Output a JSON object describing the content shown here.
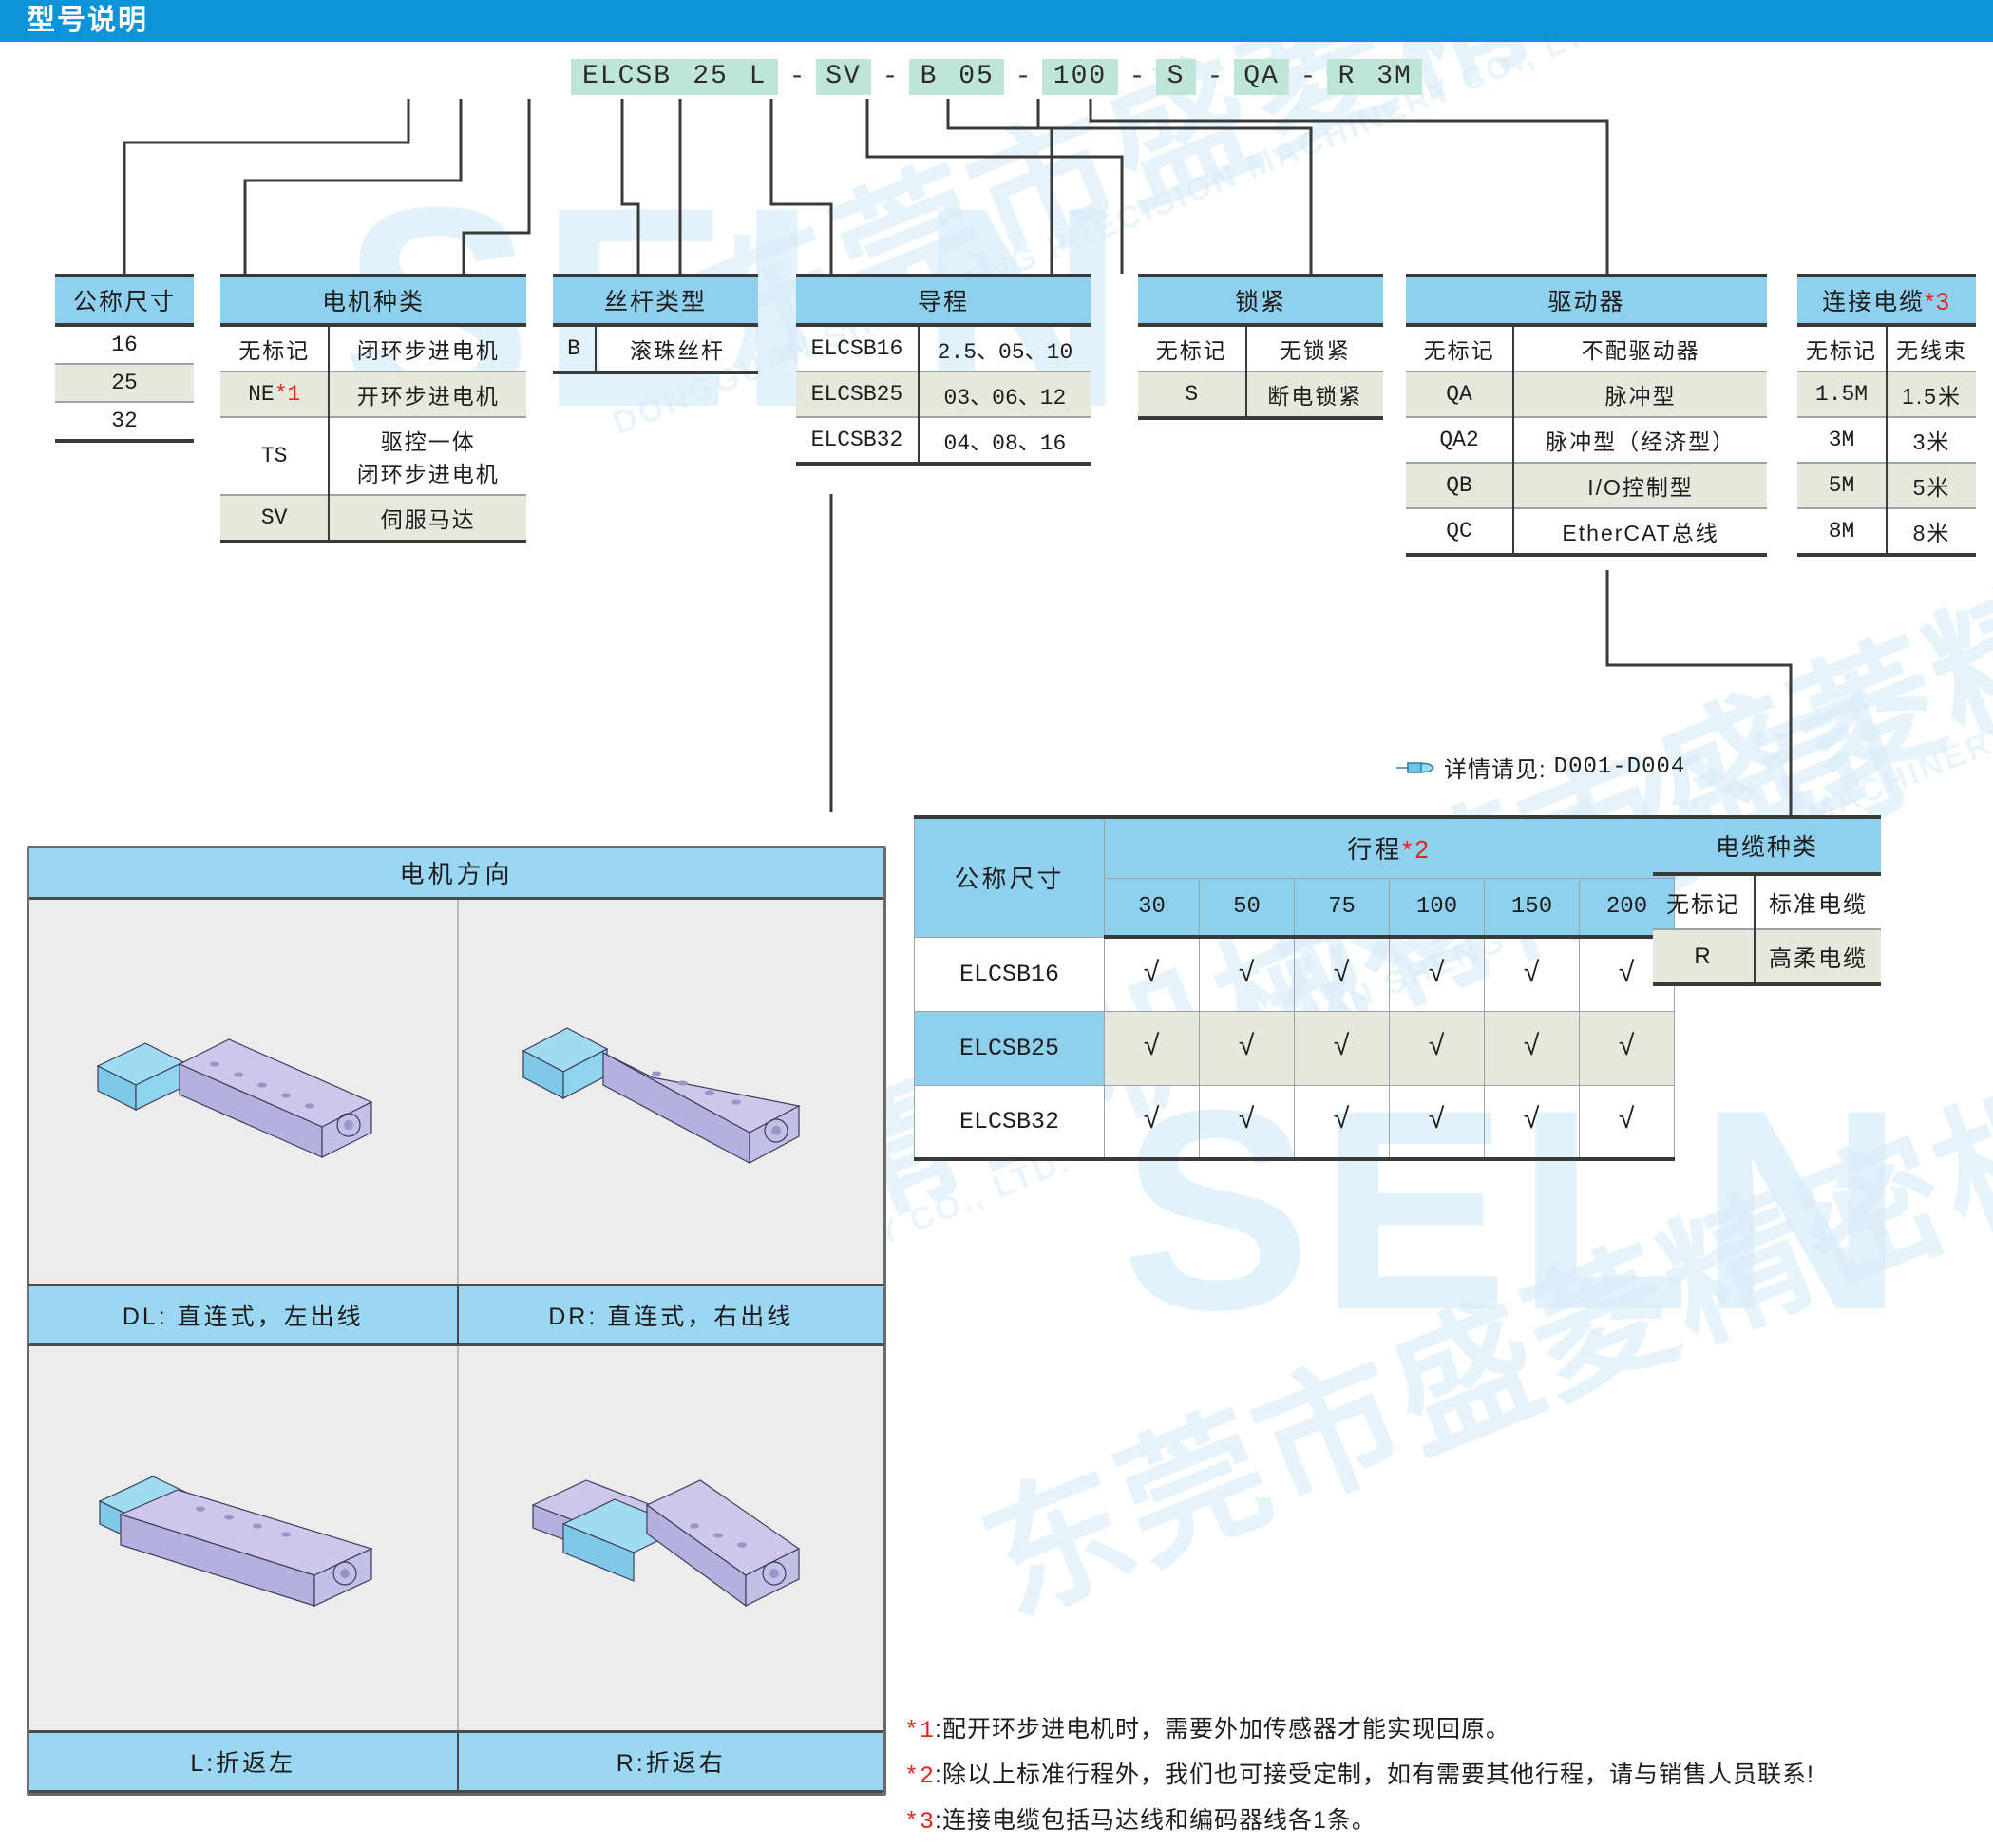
{
  "header": {
    "title": "型号说明"
  },
  "model_code": {
    "segments": [
      {
        "text": "ELCSB",
        "type": "chip",
        "width": 118
      },
      {
        "text": "25",
        "type": "chip",
        "width": 58
      },
      {
        "text": "L",
        "type": "chip",
        "width": 42
      },
      {
        "text": "-",
        "type": "dash"
      },
      {
        "text": "SV",
        "type": "chip",
        "width": 58
      },
      {
        "text": "-",
        "type": "dash"
      },
      {
        "text": "B",
        "type": "chip",
        "width": 42
      },
      {
        "text": "05",
        "type": "chip",
        "width": 58
      },
      {
        "text": "-",
        "type": "dash"
      },
      {
        "text": "100",
        "type": "chip",
        "width": 80
      },
      {
        "text": "-",
        "type": "dash"
      },
      {
        "text": "S",
        "type": "chip",
        "width": 42
      },
      {
        "text": "-",
        "type": "dash"
      },
      {
        "text": "QA",
        "type": "chip",
        "width": 58
      },
      {
        "text": "-",
        "type": "dash"
      },
      {
        "text": "R",
        "type": "chip",
        "width": 42
      },
      {
        "text": "3M",
        "type": "chip",
        "width": 58
      }
    ]
  },
  "tables": {
    "nominal_size": {
      "header": "公称尺寸",
      "rows": [
        {
          "code": "16"
        },
        {
          "code": "25"
        },
        {
          "code": "32"
        }
      ]
    },
    "motor_type": {
      "header": "电机种类",
      "rows": [
        {
          "code": "无标记",
          "desc": "闭环步进电机"
        },
        {
          "code": "NE",
          "code_star": "*1",
          "desc": "开环步进电机"
        },
        {
          "code": "TS",
          "desc": "驱控一体\n闭环步进电机"
        },
        {
          "code": "SV",
          "desc": "伺服马达"
        }
      ]
    },
    "screw_type": {
      "header": "丝杆类型",
      "rows": [
        {
          "code": "B",
          "desc": "滚珠丝杆"
        }
      ]
    },
    "lead": {
      "header": "导程",
      "rows": [
        {
          "code": "ELCSB16",
          "desc": "2.5、05、10"
        },
        {
          "code": "ELCSB25",
          "desc": "03、06、12"
        },
        {
          "code": "ELCSB32",
          "desc": "04、08、16"
        }
      ]
    },
    "lock": {
      "header": "锁紧",
      "rows": [
        {
          "code": "无标记",
          "desc": "无锁紧"
        },
        {
          "code": "S",
          "desc": "断电锁紧"
        }
      ]
    },
    "driver": {
      "header": "驱动器",
      "rows": [
        {
          "code": "无标记",
          "desc": "不配驱动器"
        },
        {
          "code": "QA",
          "desc": "脉冲型"
        },
        {
          "code": "QA2",
          "desc": "脉冲型（经济型）"
        },
        {
          "code": "QB",
          "desc": "I/O控制型"
        },
        {
          "code": "QC",
          "desc": "EtherCAT总线"
        }
      ],
      "note_prefix": "详情请见:",
      "note_code": "D001-D004"
    },
    "connect_cable": {
      "header": "连接电缆",
      "header_star": "*3",
      "rows": [
        {
          "code": "无标记",
          "desc": "无线束"
        },
        {
          "code": "1.5M",
          "desc": "1.5米"
        },
        {
          "code": "3M",
          "desc": "3米"
        },
        {
          "code": "5M",
          "desc": "5米"
        },
        {
          "code": "8M",
          "desc": "8米"
        }
      ]
    },
    "cable_type": {
      "header": "电缆种类",
      "rows": [
        {
          "code": "无标记",
          "desc": "标准电缆"
        },
        {
          "code": "R",
          "desc": "高柔电缆"
        }
      ]
    }
  },
  "motor_direction": {
    "title": "电机方向",
    "cells": [
      {
        "label": "DL: 直连式，左出线"
      },
      {
        "label": "DR: 直连式，右出线"
      },
      {
        "label": "L:折返左"
      },
      {
        "label": "R:折返右"
      }
    ]
  },
  "chart_data": {
    "type": "table",
    "title": "行程*2",
    "title_text": "行程",
    "title_star": "*2",
    "corner_label": "公称尺寸",
    "categories": [
      "30",
      "50",
      "75",
      "100",
      "150",
      "200"
    ],
    "rows": [
      {
        "name": "ELCSB16",
        "values": [
          "√",
          "√",
          "√",
          "√",
          "√",
          "√"
        ],
        "banded": false
      },
      {
        "name": "ELCSB25",
        "values": [
          "√",
          "√",
          "√",
          "√",
          "√",
          "√"
        ],
        "banded": true
      },
      {
        "name": "ELCSB32",
        "values": [
          "√",
          "√",
          "√",
          "√",
          "√",
          "√"
        ],
        "banded": false
      }
    ]
  },
  "footnotes": [
    {
      "mark": "*1",
      "text": ":配开环步进电机时，需要外加传感器才能实现回原。"
    },
    {
      "mark": "*2",
      "text": ":除以上标准行程外，我们也可接受定制，如有需要其他行程，请与销售人员联系!"
    },
    {
      "mark": "*3",
      "text": ":连接电缆包括马达线和编码器线各1条。"
    }
  ],
  "watermark": {
    "logo": "SELN",
    "cn": "东莞市盛菱精密机械有限公司",
    "en": "DONGGUAN SHENG LING PRECISION MACHINERY CO., LTD."
  },
  "colors": {
    "header_blue": "#0d93d8",
    "table_header_blue": "#8fd0ef",
    "chip_green": "#bfe5d8",
    "band_gray": "#e6e7dd",
    "star_red": "#e2231a",
    "line_dark": "#3a3a3a"
  }
}
